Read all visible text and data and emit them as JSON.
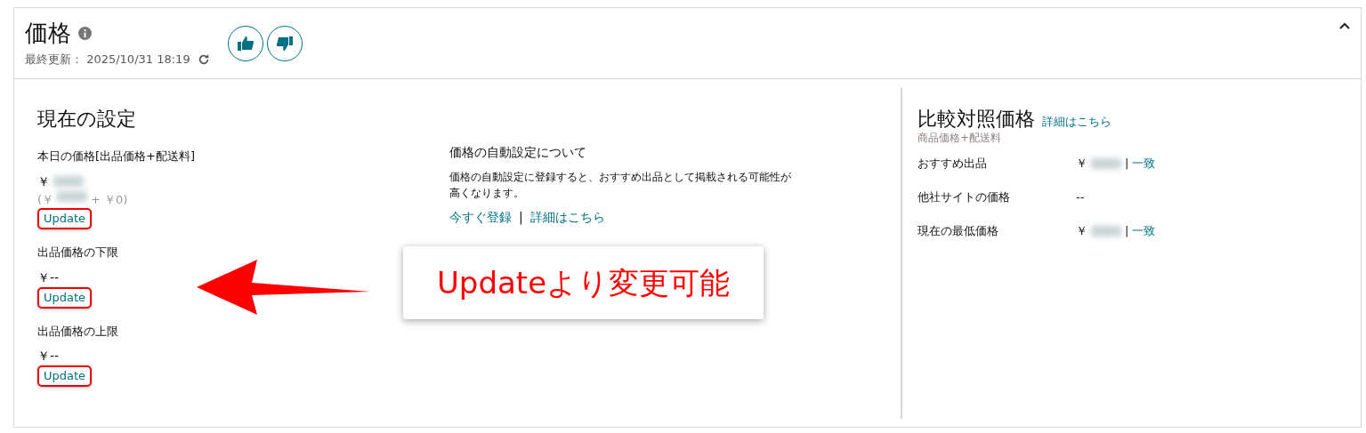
{
  "header": {
    "title": "価格",
    "last_updated_label": "最終更新：",
    "last_updated": "2025/10/31 18:19"
  },
  "current_settings": {
    "title": "現在の設定",
    "items": [
      {
        "label": "本日の価格[出品価格+配送料]",
        "value_prefix": "￥",
        "breakdown_open": "(￥",
        "breakdown_rest": "+ ￥0)",
        "redacted": true,
        "action": "Update",
        "highlighted": true
      },
      {
        "label": "出品価格の下限",
        "value_prefix": "￥--",
        "redacted": false,
        "action": "Update",
        "highlighted": true
      },
      {
        "label": "出品価格の上限",
        "value_prefix": "￥--",
        "redacted": false,
        "action": "Update",
        "highlighted": true
      }
    ]
  },
  "auto_pricing": {
    "title": "価格の自動設定について",
    "description": "価格の自動設定に登録すると、おすすめ出品として掲載される可能性が高くなります。",
    "links": [
      "今すぐ登録",
      "詳細はこちら"
    ],
    "separator": "|"
  },
  "comparison": {
    "title": "比較対照価格",
    "link": "詳細はこちら",
    "subtitle": "商品価格+配送料",
    "rows": [
      {
        "label": "おすすめ出品",
        "value": "￥",
        "redacted": true,
        "separator": "|",
        "status": "一致"
      },
      {
        "label": "他社サイトの価格",
        "value": "--",
        "redacted": false
      },
      {
        "label": "現在の最低価格",
        "value": "￥",
        "redacted": true,
        "separator": "|",
        "status": "一致"
      }
    ]
  },
  "annotation": {
    "callout": "Updateより変更可能"
  }
}
